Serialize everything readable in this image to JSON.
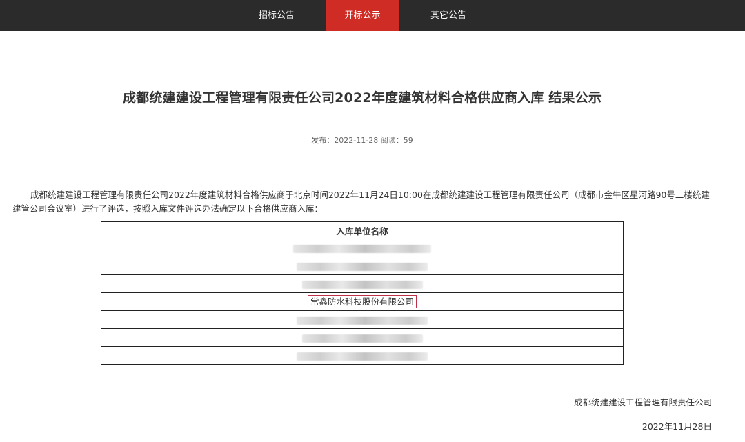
{
  "nav": {
    "items": [
      {
        "label": "招标公告",
        "active": false
      },
      {
        "label": "开标公示",
        "active": true
      },
      {
        "label": "其它公告",
        "active": false
      }
    ],
    "bar_color": "#2b2b2b",
    "active_color": "#cf2c26"
  },
  "article": {
    "title": "成都统建建设工程管理有限责任公司2022年度建筑材料合格供应商入库 结果公示",
    "meta": "发布：2022-11-28 阅读：59",
    "body": "成都统建建设工程管理有限责任公司2022年度建筑材料合格供应商于北京时间2022年11月24日10:00在成都统建建设工程管理有限责任公司（成都市金牛区星河路90号二楼统建建管公司会议室）进行了评选，按照入库文件评选办法确定以下合格供应商入库："
  },
  "table": {
    "header": "入库单位名称",
    "rows": [
      {
        "text": "",
        "blurred": true
      },
      {
        "text": "",
        "blurred": true
      },
      {
        "text": "",
        "blurred": true
      },
      {
        "text": "常鑫防水科技股份有限公司",
        "blurred": false,
        "highlighted": true
      },
      {
        "text": "",
        "blurred": true
      },
      {
        "text": "",
        "blurred": true
      },
      {
        "text": "",
        "blurred": true
      }
    ],
    "highlight_color": "#c0304a"
  },
  "footer": {
    "company": "成都统建建设工程管理有限责任公司",
    "date": "2022年11月28日"
  }
}
